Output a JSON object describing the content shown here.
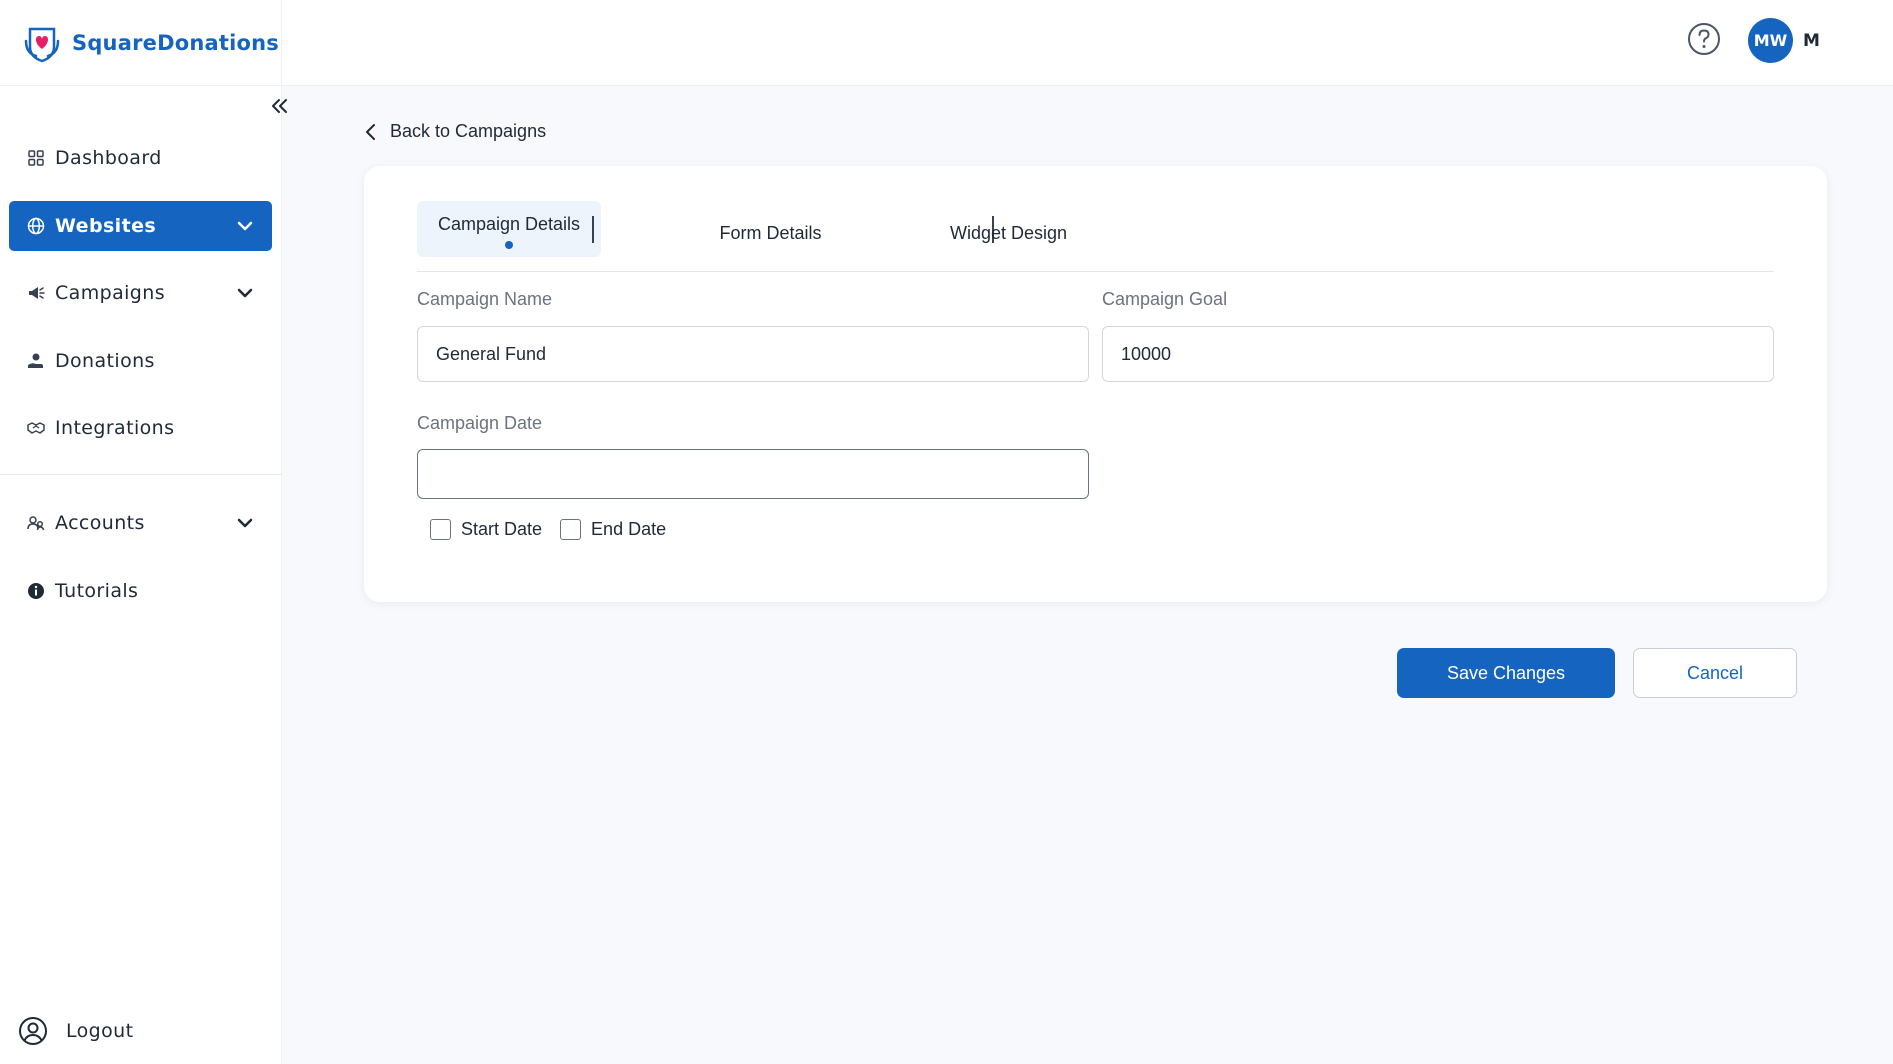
{
  "brand": {
    "name": "SquareDonations",
    "logo_icon": "heart-hands-icon"
  },
  "colors": {
    "primary": "#1565c0",
    "active_tab_bg": "#eef4fb",
    "page_bg": "#f7f9fc"
  },
  "sidebar": {
    "items": [
      {
        "label": "Dashboard",
        "icon": "grid-icon",
        "active": false,
        "expandable": false
      },
      {
        "label": "Websites",
        "icon": "globe-icon",
        "active": true,
        "expandable": true
      },
      {
        "label": "Campaigns",
        "icon": "megaphone-icon",
        "active": false,
        "expandable": true
      },
      {
        "label": "Donations",
        "icon": "donation-hand-icon",
        "active": false,
        "expandable": false
      },
      {
        "label": "Integrations",
        "icon": "handshake-icon",
        "active": false,
        "expandable": false
      }
    ],
    "items2": [
      {
        "label": "Accounts",
        "icon": "users-icon",
        "active": false,
        "expandable": true
      },
      {
        "label": "Tutorials",
        "icon": "info-icon",
        "active": false,
        "expandable": false
      }
    ],
    "logout_label": "Logout"
  },
  "header": {
    "avatar_initials": "MW",
    "user_initial": "M"
  },
  "main": {
    "back_label": "Back to Campaigns",
    "tabs": [
      {
        "label": "Campaign Details",
        "active": true
      },
      {
        "label": "Form Details",
        "active": false
      },
      {
        "label": "Widget Design",
        "active": false
      }
    ],
    "form": {
      "campaign_name_label": "Campaign Name",
      "campaign_name_value": "General Fund",
      "campaign_goal_label": "Campaign Goal",
      "campaign_goal_value": "10000",
      "campaign_date_label": "Campaign Date",
      "campaign_date_value": "",
      "start_date_label": "Start Date",
      "start_date_checked": false,
      "end_date_label": "End Date",
      "end_date_checked": false
    },
    "save_label": "Save Changes",
    "cancel_label": "Cancel"
  }
}
